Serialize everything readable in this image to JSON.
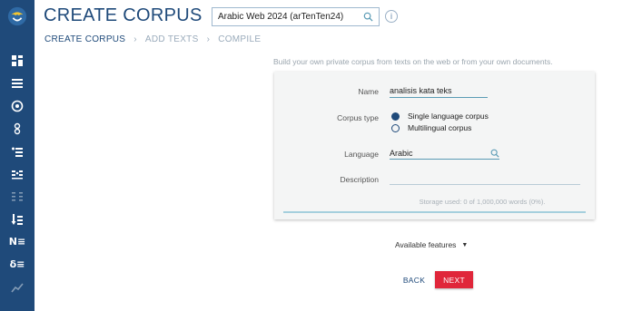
{
  "header": {
    "title": "CREATE CORPUS",
    "corpus_select": "Arabic Web 2024 (arTenTen24)"
  },
  "breadcrumb": [
    {
      "label": "CREATE CORPUS"
    },
    {
      "label": "ADD TEXTS"
    },
    {
      "label": "COMPILE"
    }
  ],
  "intro": "Build your own private corpus from texts on the web or from your own documents.",
  "form": {
    "name_label": "Name",
    "name_value": "analisis kata teks",
    "corpus_type_label": "Corpus type",
    "corpus_type_options": [
      "Single language corpus",
      "Multilingual corpus"
    ],
    "corpus_type_selected": "Single language corpus",
    "language_label": "Language",
    "language_value": "Arabic",
    "description_label": "Description",
    "description_value": "",
    "storage": "Storage used: 0 of 1,000,000 words (0%)."
  },
  "features_label": "Available features",
  "actions": {
    "back": "BACK",
    "next": "NEXT"
  },
  "colors": {
    "sidebar": "#1f4a7a",
    "accent": "#1f4a7a",
    "next_button": "#e0263a"
  }
}
